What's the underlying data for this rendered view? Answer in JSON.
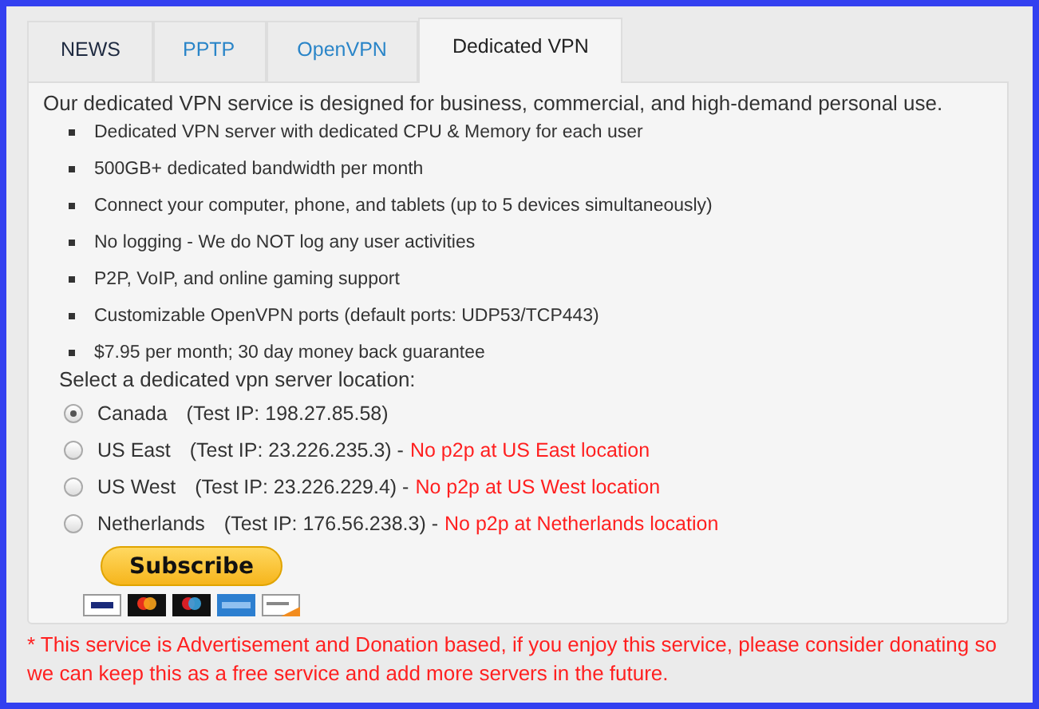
{
  "tabs": [
    {
      "label": "NEWS",
      "selected": false
    },
    {
      "label": "PPTP",
      "selected": false
    },
    {
      "label": "OpenVPN",
      "selected": false
    },
    {
      "label": "Dedicated VPN",
      "selected": true
    }
  ],
  "intro": "Our dedicated VPN service is designed for business, commercial, and high-demand personal use.",
  "features": [
    "Dedicated VPN server with dedicated CPU & Memory for each user",
    "500GB+ dedicated bandwidth per month",
    "Connect your computer, phone, and tablets (up to 5 devices simultaneously)",
    "No logging - We do NOT log any user activities",
    "P2P, VoIP, and online gaming support",
    "Customizable OpenVPN ports (default ports: UDP53/TCP443)",
    "$7.95 per month; 30 day money back guarantee"
  ],
  "location_prompt": "Select a dedicated vpn server location:",
  "locations": [
    {
      "name": "Canada",
      "test_ip": "(Test IP: 198.27.85.58)",
      "selected": true
    },
    {
      "name": "US East",
      "test_ip": "(Test IP: 23.226.235.3) -",
      "note": "No p2p at US East location",
      "selected": false
    },
    {
      "name": "US West",
      "test_ip": "(Test IP: 23.226.229.4) -",
      "note": "No p2p at US West location",
      "selected": false
    },
    {
      "name": "Netherlands",
      "test_ip": "(Test IP: 176.56.238.3) -",
      "note": "No p2p at Netherlands location",
      "selected": false
    }
  ],
  "subscribe_button": "Subscribe",
  "payment_cards": [
    {
      "kind": "visa"
    },
    {
      "kind": "mastercard"
    },
    {
      "kind": "maestro"
    },
    {
      "kind": "amex"
    },
    {
      "kind": "discover"
    }
  ],
  "footer_note": "* This service is Advertisement and Donation based, if you enjoy this service, please consider donating so we can keep this as a free service and add more servers in the future."
}
